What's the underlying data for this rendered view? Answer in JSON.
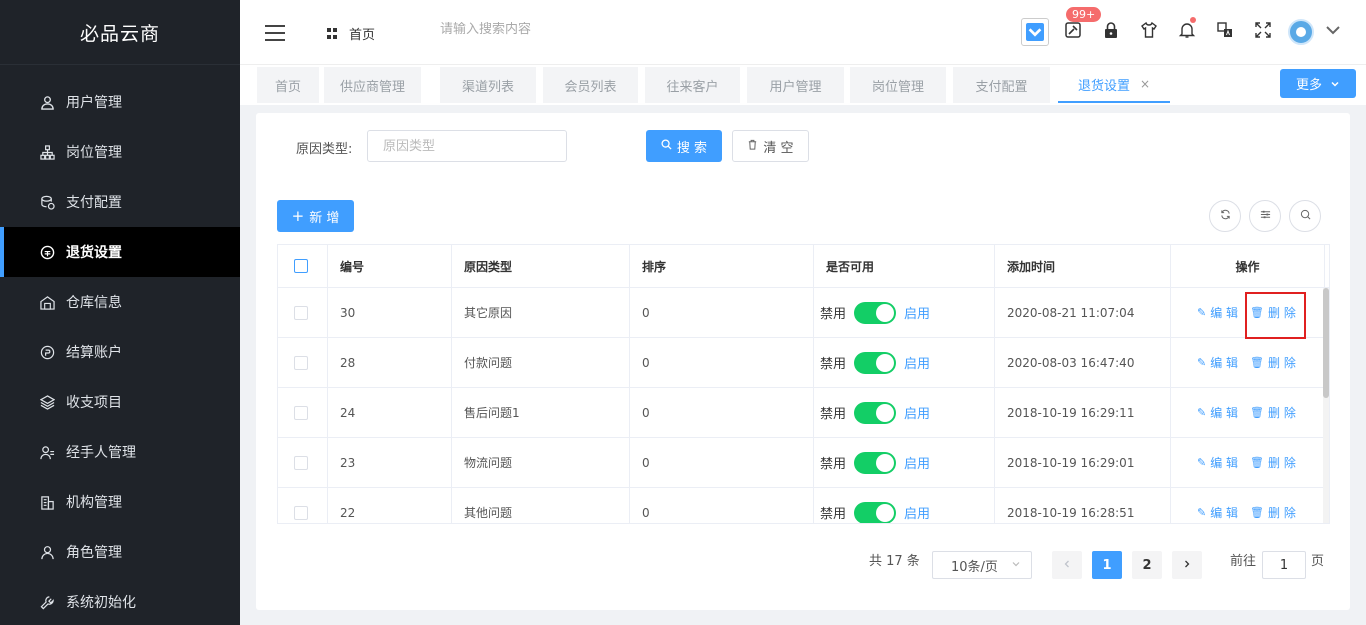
{
  "sidebar": {
    "brand": "必品云商",
    "items": [
      {
        "label": "用户管理",
        "icon": "user-icon"
      },
      {
        "label": "岗位管理",
        "icon": "org-icon"
      },
      {
        "label": "支付配置",
        "icon": "coins-icon"
      },
      {
        "label": "退货设置",
        "icon": "return-icon",
        "active": true
      },
      {
        "label": "仓库信息",
        "icon": "warehouse-icon"
      },
      {
        "label": "结算账户",
        "icon": "account-icon"
      },
      {
        "label": "收支项目",
        "icon": "layers-icon"
      },
      {
        "label": "经手人管理",
        "icon": "handler-icon"
      },
      {
        "label": "机构管理",
        "icon": "building-icon"
      },
      {
        "label": "角色管理",
        "icon": "role-icon"
      },
      {
        "label": "系统初始化",
        "icon": "wrench-icon"
      }
    ]
  },
  "header": {
    "home": "首页",
    "search_placeholder": "请输入搜索内容",
    "badge": "99+"
  },
  "tabs": [
    "首页",
    "供应商管理",
    "渠道列表",
    "会员列表",
    "往来客户",
    "用户管理",
    "岗位管理",
    "支付配置",
    "退货设置"
  ],
  "more_label": "更多",
  "filter": {
    "label": "原因类型:",
    "placeholder": "原因类型",
    "search_btn": "搜 索",
    "clear_btn": "清 空"
  },
  "add_btn": "新 增",
  "table": {
    "headers": [
      "编号",
      "原因类型",
      "排序",
      "是否可用",
      "添加时间",
      "操作"
    ],
    "rows": [
      {
        "id": "30",
        "type": "其它原因",
        "sort": "0",
        "time": "2020-08-21 11:07:04"
      },
      {
        "id": "28",
        "type": "付款问题",
        "sort": "0",
        "time": "2020-08-03 16:47:40"
      },
      {
        "id": "24",
        "type": "售后问题1",
        "sort": "0",
        "time": "2018-10-19 16:29:11"
      },
      {
        "id": "23",
        "type": "物流问题",
        "sort": "0",
        "time": "2018-10-19 16:29:01"
      },
      {
        "id": "22",
        "type": "其他问题",
        "sort": "0",
        "time": "2018-10-19 16:28:51"
      }
    ],
    "off_label": "禁用",
    "on_label": "启用",
    "edit_label": "编 辑",
    "delete_label": "删 除"
  },
  "pagination": {
    "total": "共 17 条",
    "page_size": "10条/页",
    "pages": [
      "1",
      "2"
    ],
    "current": "1",
    "goto_label": "前往",
    "goto_value": "1",
    "page_suffix": "页"
  },
  "colors": {
    "accent": "#409eff",
    "switch_on": "#13ce66",
    "sidebar_bg": "#1f2329",
    "highlight": "#e02020"
  }
}
